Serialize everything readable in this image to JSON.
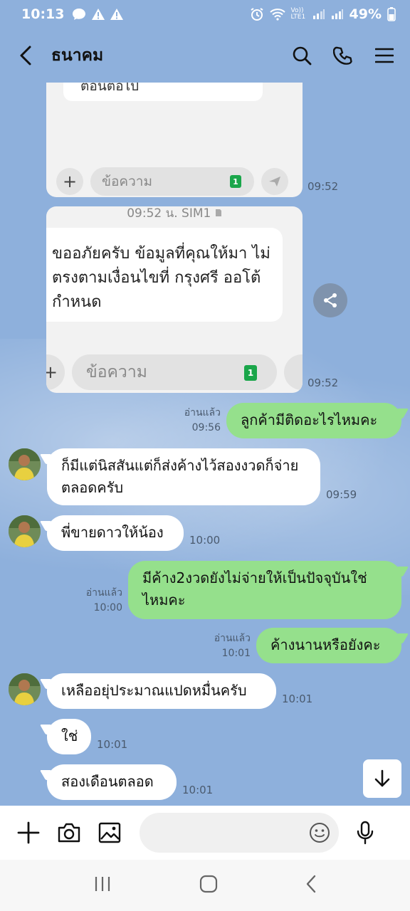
{
  "status_bar": {
    "time": "10:13",
    "battery": "49%",
    "network": "Vo)) LTE1"
  },
  "header": {
    "title": "ธนาคม"
  },
  "screenshot1": {
    "cut_text": "ต้อนต่อไป",
    "input_placeholder": "ข้อความ",
    "sim": "1",
    "time": "09:52"
  },
  "screenshot2": {
    "header": "09:52 น. SIM1",
    "message": "ขออภัยครับ ข้อมูลที่คุณให้มา ไม่ตรงตามเงื่อนไขที่ กรุงศรี ออโต้ กำหนด",
    "input_placeholder": "ข้อความ",
    "sim": "1",
    "time": "09:52"
  },
  "messages": [
    {
      "id": "m1",
      "dir": "out",
      "text": "ลูกค้ามีติดอะไรไหมคะ",
      "read": "อ่านแล้ว",
      "time": "09:56"
    },
    {
      "id": "m2",
      "dir": "in",
      "text": "ก็มีแต่นิสสันแต่ก็ส่งค้างไว้สองงวดก็จ่ายตลอดครับ",
      "time": "09:59"
    },
    {
      "id": "m3",
      "dir": "in",
      "text": "พี่ขายดาวให้น้อง",
      "time": "10:00"
    },
    {
      "id": "m4",
      "dir": "out",
      "text": "มีค้าง2งวดยังไม่จ่ายให้เป็นปัจจุบันใช่ไหมคะ",
      "read": "อ่านแล้ว",
      "time": "10:00"
    },
    {
      "id": "m5",
      "dir": "out",
      "text": "ค้างนานหรือยังคะ",
      "read": "อ่านแล้ว",
      "time": "10:01"
    },
    {
      "id": "m6",
      "dir": "in",
      "text": "เหลืออยุ่ประมาณแปดหมื่นครับ",
      "time": "10:01"
    },
    {
      "id": "m7",
      "dir": "in",
      "text": "ใช่",
      "time": "10:01"
    },
    {
      "id": "m8",
      "dir": "in",
      "text": "สองเดือนตลอด",
      "time": "10:01"
    }
  ],
  "colors": {
    "background": "#8eb0dc",
    "outgoing_bubble": "#95e08c",
    "incoming_bubble": "#ffffff",
    "sim_badge": "#1aa64a"
  },
  "icons": {
    "header": [
      "back-icon",
      "search-icon",
      "phone-icon",
      "menu-icon"
    ],
    "input_bar": [
      "plus-icon",
      "camera-icon",
      "image-icon",
      "emoji-icon",
      "mic-icon"
    ],
    "nav": [
      "recent-apps-icon",
      "home-icon",
      "back-nav-icon"
    ]
  }
}
